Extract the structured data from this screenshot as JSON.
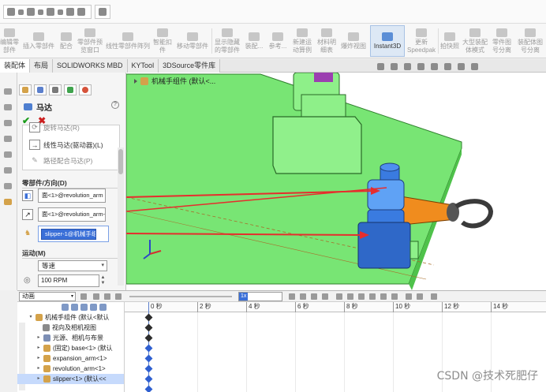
{
  "ribbon": {
    "items": [
      "编辑零\n部件",
      "插入零部件",
      "配合",
      "零部件预\n览窗口",
      "线性零部件阵列",
      "智能扣\n件",
      "移动零部件",
      "显示隐藏\n的零部件",
      "装配...",
      "参考...",
      "新建运\n动算例",
      "材料明\n细表",
      "爆炸视图",
      "Instant3D",
      "更新\nSpeedpak",
      "拍快照",
      "大型装配\n体模式",
      "零件图\n号分离",
      "装配体图\n号分离"
    ],
    "active_item": "Instant3D"
  },
  "tabs": [
    "装配体",
    "布局",
    "SOLIDWORKS MBD",
    "KYTool",
    "3DSource零件库"
  ],
  "active_tab": "装配体",
  "property_manager": {
    "title": "马达",
    "help": "?",
    "ok": "✔",
    "cancel": "✖",
    "motor_options": [
      {
        "label": "旋转马达(R)",
        "dim": true
      },
      {
        "label": "线性马达(驱动器)(L)",
        "dim": false
      },
      {
        "label": "路径配合马达(P)",
        "dim": true
      }
    ],
    "component_section": "零部件/方向(D)",
    "direction_field_1": "面<1>@revolution_arm",
    "direction_field_2": "面<1>@revolution_arm-",
    "component_field": "slipper-1@机械手组",
    "motion_section": "运动(M)",
    "motion_type": "等速",
    "speed": "100 RPM"
  },
  "viewport": {
    "title": "机械手组件 (默认<..."
  },
  "motion_manager": {
    "study_type": "动画",
    "speed_value": "1x",
    "timeline_ticks": [
      "0 秒",
      "2 秒",
      "4 秒",
      "6 秒",
      "8 秒",
      "10 秒",
      "12 秒",
      "14 秒"
    ],
    "tree": [
      {
        "label": "机械手组件 (默认<默认",
        "selected": false
      },
      {
        "label": "视向及相机视图",
        "selected": false
      },
      {
        "label": "光源、相机与布景",
        "selected": false
      },
      {
        "label": "(固定) base<1> (默认",
        "selected": false
      },
      {
        "label": "expansion_arm<1>",
        "selected": false
      },
      {
        "label": "revolution_arm<1>",
        "selected": false
      },
      {
        "label": "slipper<1> (默认<<",
        "selected": true
      }
    ]
  },
  "watermark": "CSDN @技术死肥仔",
  "colors": {
    "plate": "#7ee87a",
    "part_green": "#8ff18a",
    "arm_orange": "#f08c1e",
    "slipper_blue": "#3a7be0",
    "arrow_red": "#e62d2d",
    "selection_blue": "#3a6fd8"
  }
}
